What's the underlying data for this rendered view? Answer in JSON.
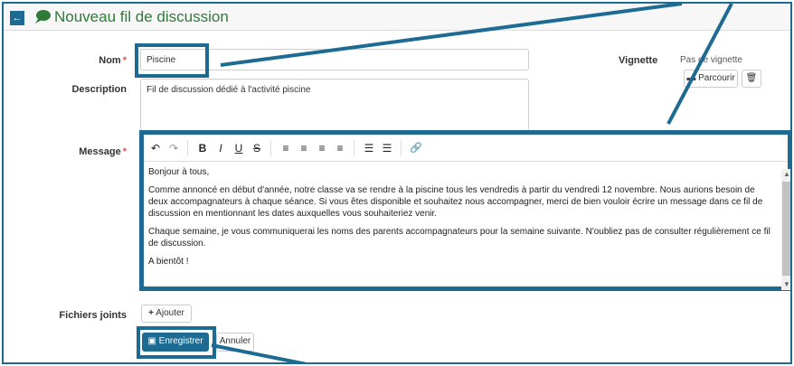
{
  "header": {
    "back_icon": "arrow-left-icon",
    "title_icon": "comments-icon",
    "title": "Nouveau fil de discussion"
  },
  "form": {
    "nom": {
      "label": "Nom",
      "required_mark": "*",
      "value": "Piscine"
    },
    "description": {
      "label": "Description",
      "value": "Fil de discussion dédié à l'activité piscine"
    },
    "vignette": {
      "label": "Vignette",
      "empty_text": "Pas de vignette",
      "browse_label": "Parcourir",
      "browse_icon": "folder-icon",
      "delete_icon": "trash-icon"
    },
    "message": {
      "label": "Message",
      "required_mark": "*",
      "paragraphs": [
        "Bonjour à tous,",
        "Comme annoncé en début d'année, notre classe va se rendre à la piscine tous les vendredis à partir du vendredi 12 novembre. Nous aurions besoin de deux accompagnateurs à chaque séance. Si vous êtes disponible et souhaitez nous accompagner, merci de bien vouloir écrire un message dans ce fil de discussion en mentionnant les dates auxquelles vous souhaiteriez venir.",
        "Chaque semaine, je vous communiquerai les noms des parents accompagnateurs pour la semaine suivante. N'oubliez pas de consulter régulièrement ce fil de discussion.",
        "A bientôt !"
      ]
    },
    "fichiers": {
      "label": "Fichiers joints",
      "add_label": "Ajouter",
      "add_icon": "plus-icon"
    }
  },
  "toolbar": {
    "undo": "↶",
    "redo": "↷",
    "bold": "B",
    "italic": "I",
    "underline": "U",
    "strike": "S",
    "align_left": "≡",
    "align_center": "≡",
    "align_right": "≡",
    "justify": "≡",
    "bullet_list": "☰",
    "numbered_list": "☰",
    "link": "🔗"
  },
  "actions": {
    "save_label": "Enregistrer",
    "save_icon": "save-icon",
    "cancel_label": "Annuler"
  },
  "colors": {
    "accent": "#1d6a93",
    "title_green": "#2f7a38",
    "required_red": "#d9534f"
  }
}
